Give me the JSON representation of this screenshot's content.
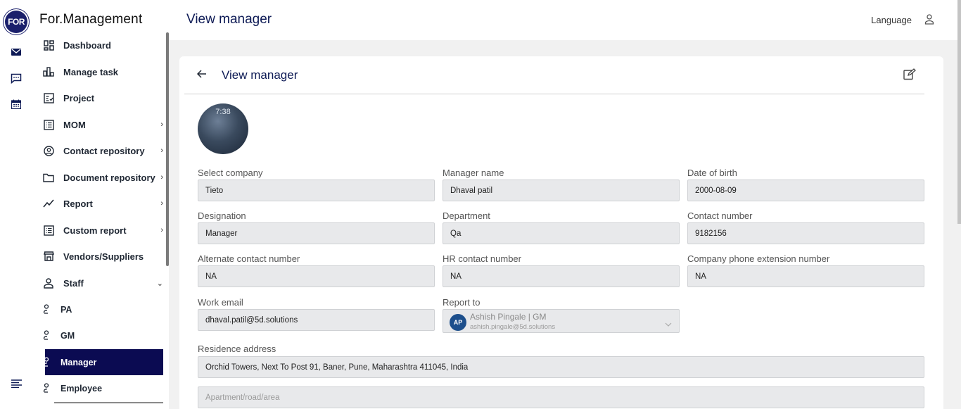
{
  "brand": {
    "logo_text": "FOR",
    "name": "For.Management"
  },
  "rail": {
    "icons": [
      "mail-icon",
      "chat-icon",
      "calendar-icon",
      "menu-icon"
    ]
  },
  "sidebar": {
    "items": [
      {
        "label": "Dashboard",
        "icon": "dashboard-icon",
        "chevron": ""
      },
      {
        "label": "Manage task",
        "icon": "bar-chart-icon",
        "chevron": ""
      },
      {
        "label": "Project",
        "icon": "project-icon",
        "chevron": ""
      },
      {
        "label": "MOM",
        "icon": "list-icon",
        "chevron": "›"
      },
      {
        "label": "Contact repository",
        "icon": "contact-icon",
        "chevron": "›"
      },
      {
        "label": "Document repository",
        "icon": "folder-icon",
        "chevron": "›"
      },
      {
        "label": "Report",
        "icon": "trend-icon",
        "chevron": "›"
      },
      {
        "label": "Custom report",
        "icon": "list-icon",
        "chevron": "›"
      },
      {
        "label": "Vendors/Suppliers",
        "icon": "store-icon",
        "chevron": ""
      },
      {
        "label": "Staff",
        "icon": "person-icon",
        "chevron": "⌄"
      }
    ],
    "staff_sub": [
      {
        "label": "PA",
        "active": false
      },
      {
        "label": "GM",
        "active": false
      },
      {
        "label": "Manager",
        "active": true
      },
      {
        "label": "Employee",
        "active": false
      }
    ]
  },
  "header": {
    "title": "View manager",
    "language": "Language"
  },
  "card": {
    "title": "View manager",
    "avatar_clock": "7:38",
    "fields": {
      "company": {
        "label": "Select company",
        "value": "Tieto"
      },
      "manager_name": {
        "label": "Manager name",
        "value": "Dhaval patil"
      },
      "dob": {
        "label": "Date of birth",
        "value": "2000-08-09"
      },
      "designation": {
        "label": "Designation",
        "value": "Manager"
      },
      "department": {
        "label": "Department",
        "value": "Qa"
      },
      "contact": {
        "label": "Contact number",
        "value": "9182156"
      },
      "alt_contact": {
        "label": "Alternate contact number",
        "value": "NA"
      },
      "hr_contact": {
        "label": "HR contact number",
        "value": "NA"
      },
      "extension": {
        "label": "Company phone extension number",
        "value": "NA"
      },
      "work_email": {
        "label": "Work email",
        "value": "dhaval.patil@5d.solutions"
      },
      "report_to": {
        "label": "Report to",
        "initials": "AP",
        "name": "Ashish Pingale | GM",
        "email": "ashish.pingale@5d.solutions"
      },
      "residence": {
        "label": "Residence address",
        "value": "Orchid Towers, Next To Post 91, Baner, Pune, Maharashtra 411045, India"
      },
      "apartment": {
        "placeholder": "Apartment/road/area"
      }
    }
  }
}
